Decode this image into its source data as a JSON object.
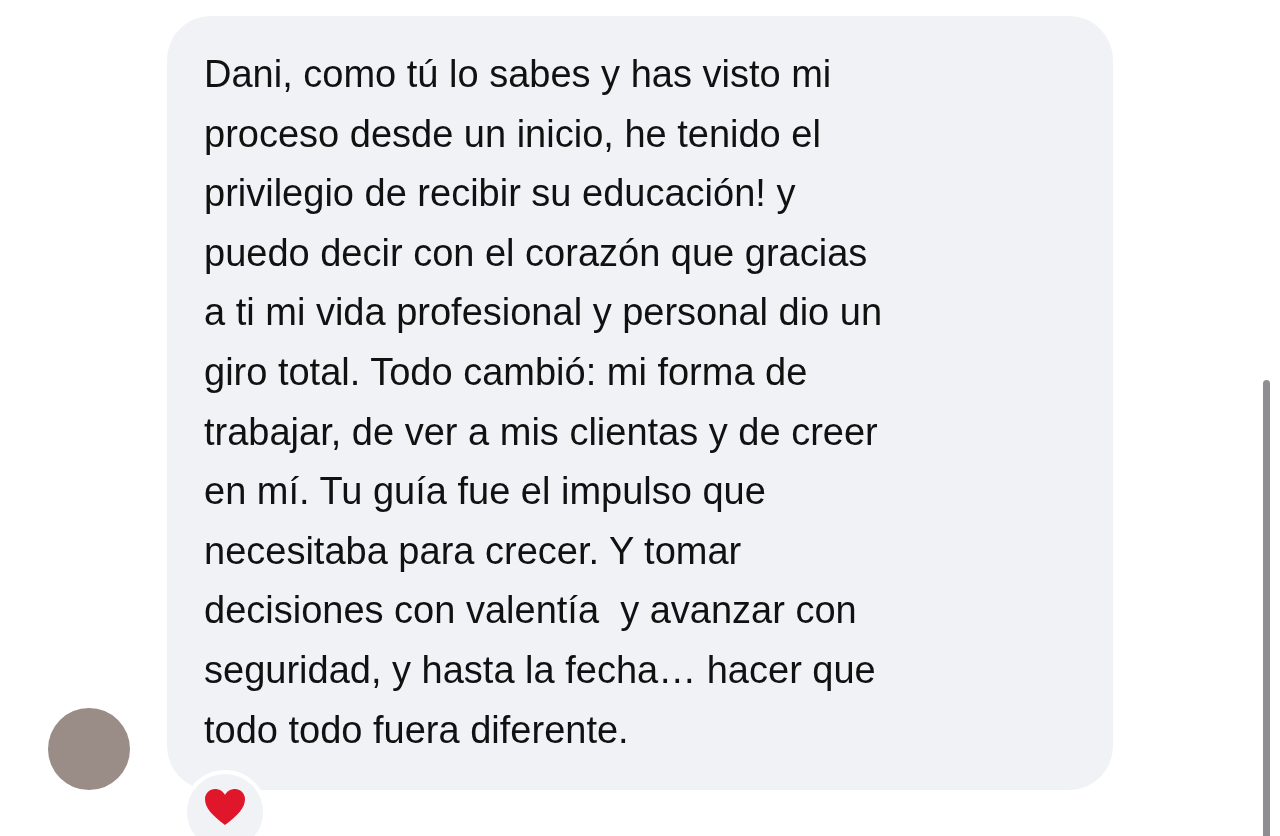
{
  "message": {
    "text": "Dani, como tú lo sabes y has visto mi\nproceso desde un inicio, he tenido el\nprivilegio de recibir su educación! y\npuedo decir con el corazón que gracias\na ti mi vida profesional y personal dio un\ngiro total. Todo cambió: mi forma de\ntrabajar, de ver a mis clientas y de creer\nen mí. Tu guía fue el impulso que\nnecesitaba para crecer. Y tomar\ndecisiones con valentía  y avanzar con\nseguridad, y hasta la fecha… hacer que\ntodo todo fuera diferente."
  }
}
